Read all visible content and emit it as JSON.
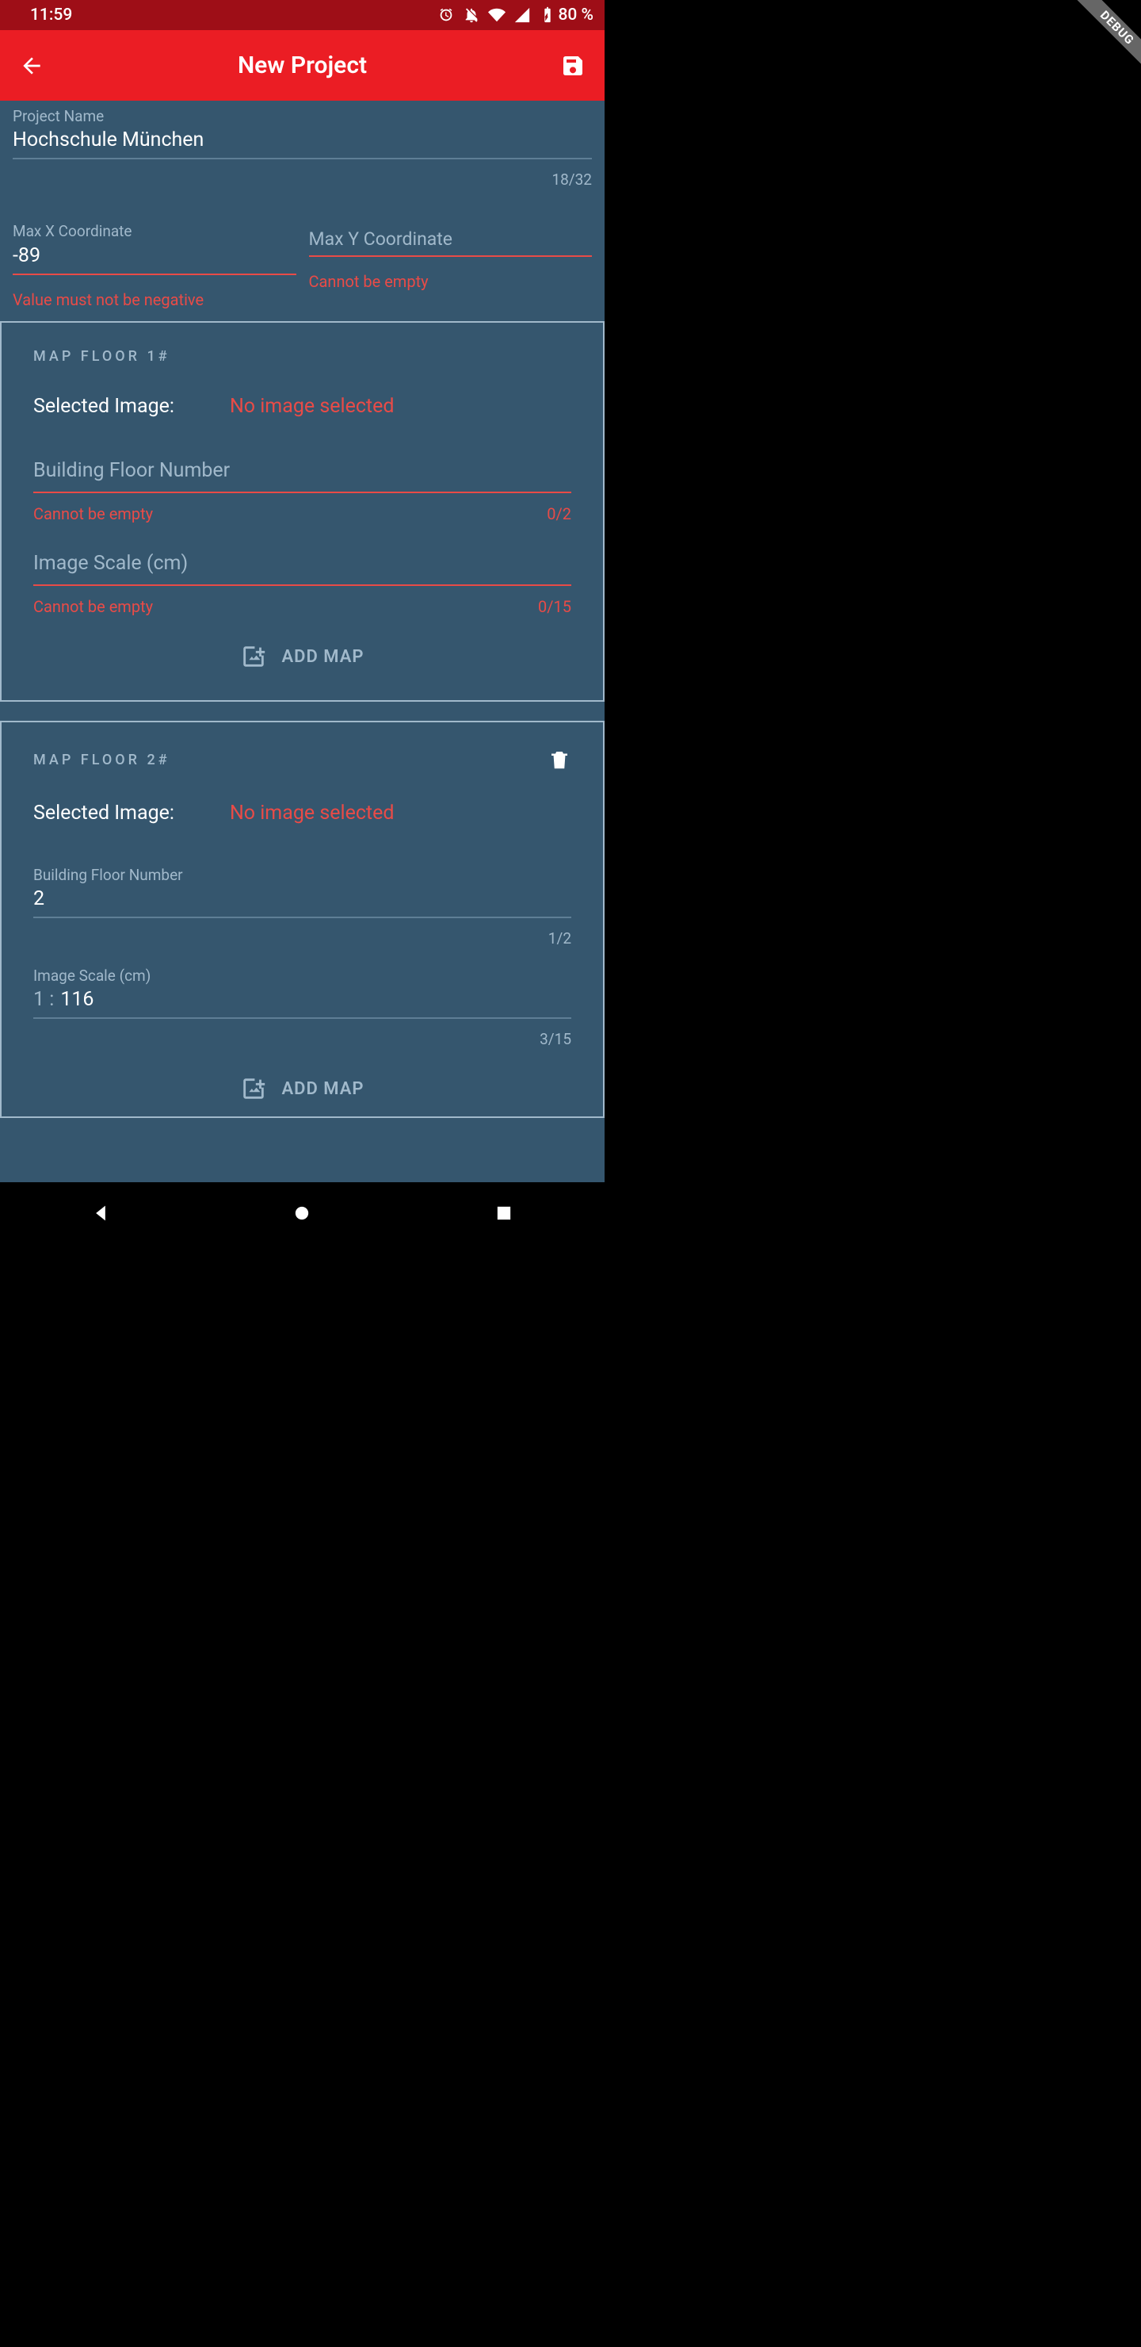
{
  "status": {
    "time": "11:59",
    "battery_pct": "80 %"
  },
  "debug_ribbon": "DEBUG",
  "appbar": {
    "title": "New Project"
  },
  "project_name": {
    "label": "Project Name",
    "value": "Hochschule München",
    "counter": "18/32"
  },
  "max_x": {
    "label": "Max X Coordinate",
    "value": "-89",
    "error": "Value must not be negative"
  },
  "max_y": {
    "label": "Max Y Coordinate",
    "value": "",
    "error": "Cannot be empty"
  },
  "floors": [
    {
      "title": "MAP FLOOR 1#",
      "deletable": false,
      "selected_image_label": "Selected Image:",
      "selected_image_value": "No image selected",
      "floor_num": {
        "label": "Building Floor Number",
        "value": "",
        "error": "Cannot be empty",
        "counter": "0/2"
      },
      "scale": {
        "label": "Image Scale (cm)",
        "prefix": "",
        "value": "",
        "error": "Cannot be empty",
        "counter": "0/15"
      },
      "add_map_label": "ADD MAP"
    },
    {
      "title": "MAP FLOOR 2#",
      "deletable": true,
      "selected_image_label": "Selected Image:",
      "selected_image_value": "No image selected",
      "floor_num": {
        "label": "Building Floor Number",
        "value": "2",
        "error": "",
        "counter": "1/2"
      },
      "scale": {
        "label": "Image Scale (cm)",
        "prefix": "1 :",
        "value": "116",
        "error": "",
        "counter": "3/15"
      },
      "add_map_label": "ADD MAP"
    }
  ]
}
